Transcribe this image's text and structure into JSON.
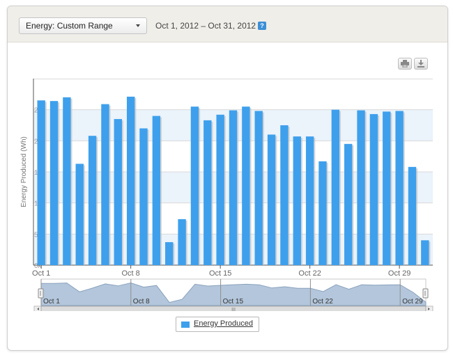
{
  "toolbar": {
    "range_select": "Energy: Custom Range",
    "date_range": "Oct 1, 2012 – Oct 31, 2012",
    "help_icon": "?",
    "print_icon": "printer-icon",
    "download_icon": "download-icon"
  },
  "navigator": {
    "labels": [
      "Oct 1",
      "Oct 8",
      "Oct 15",
      "Oct 22",
      "Oct 29"
    ],
    "scroll_grip": "III"
  },
  "legend": {
    "label": "Energy Produced"
  },
  "colors": {
    "bar": "#3ea0ec",
    "band": "#ebf3fb",
    "nav_fill": "#b3c6db"
  },
  "chart_data": {
    "type": "bar",
    "title": "",
    "xlabel": "",
    "ylabel": "Energy Produced (Wh)",
    "ylim": [
      0,
      30000
    ],
    "yticks": [
      "0k",
      "5k",
      "10k",
      "15k",
      "20k",
      "25k"
    ],
    "xtick_labels": [
      "Oct 1",
      "Oct 8",
      "Oct 15",
      "Oct 22",
      "Oct 29"
    ],
    "categories": [
      "Oct 1",
      "Oct 2",
      "Oct 3",
      "Oct 4",
      "Oct 5",
      "Oct 6",
      "Oct 7",
      "Oct 8",
      "Oct 9",
      "Oct 10",
      "Oct 11",
      "Oct 12",
      "Oct 13",
      "Oct 14",
      "Oct 15",
      "Oct 16",
      "Oct 17",
      "Oct 18",
      "Oct 19",
      "Oct 20",
      "Oct 21",
      "Oct 22",
      "Oct 23",
      "Oct 24",
      "Oct 25",
      "Oct 26",
      "Oct 27",
      "Oct 28",
      "Oct 29",
      "Oct 30",
      "Oct 31"
    ],
    "series": [
      {
        "name": "Energy Produced",
        "values": [
          26500,
          26400,
          27000,
          16300,
          20800,
          25900,
          23500,
          27100,
          22000,
          24000,
          3700,
          7400,
          25500,
          23300,
          24200,
          24900,
          25500,
          24800,
          21000,
          22500,
          20700,
          20700,
          16700,
          25000,
          19500,
          24900,
          24300,
          24700,
          24800,
          15800,
          4000
        ]
      }
    ],
    "grid": true,
    "legend_position": "bottom-center"
  }
}
